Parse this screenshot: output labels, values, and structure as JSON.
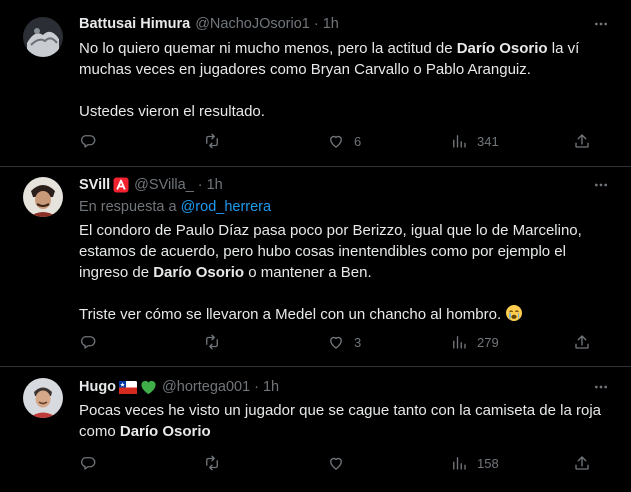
{
  "tweets": [
    {
      "name": "Battusai Himura",
      "handle": "@NachoJOsorio1",
      "sep": "·",
      "time": "1h",
      "paragraphs": [
        [
          "No lo quiero quemar ni mucho menos, pero la actitud de ",
          "Darío Osorio",
          " la ví muchas veces en jugadores como Bryan Carvallo o Pablo Aranguiz."
        ],
        [
          "Ustedes vieron el resultado."
        ]
      ],
      "reply_count": "",
      "like_count": "6",
      "view_count": "341"
    },
    {
      "name": "SVill",
      "name_badge": "🅰",
      "handle": "@SVilla_",
      "sep": "·",
      "time": "1h",
      "reply_prefix": "En respuesta a ",
      "reply_target": "@rod_herrera",
      "paragraphs": [
        [
          "El condoro de Paulo Díaz pasa poco por Berizzo, igual que lo de Marcelino, estamos de acuerdo, pero hubo cosas inentendibles como por ejemplo el ingreso de ",
          "Darío Osorio",
          " o mantener a Ben."
        ],
        [
          "Triste ver cómo se llevaron a Medel con un chancho al hombro. "
        ]
      ],
      "reply_count": "",
      "like_count": "3",
      "view_count": "279"
    },
    {
      "name": "Hugo",
      "handle": "@hortega001",
      "sep": "·",
      "time": "1h",
      "paragraphs": [
        [
          "Pocas veces he visto un jugador que se cague tanto con la camiseta de la roja como ",
          "Darío Osorio",
          ""
        ]
      ],
      "reply_count": "",
      "like_count": "",
      "view_count": "158"
    }
  ],
  "icons": {
    "reply": "reply-icon",
    "retweet": "retweet-icon",
    "like": "heart-icon",
    "views": "views-icon",
    "share": "share-icon",
    "more": "more-icon",
    "cry_emoji": "crying-face-emoji",
    "chile_flag": "chile-flag-icon",
    "green_heart": "green-heart-icon"
  },
  "colors": {
    "background": "#000000",
    "text": "#e7e9ea",
    "muted": "#71767b",
    "link": "#1d9bf0",
    "border": "#2f3336",
    "badge_red": "#f4212e"
  }
}
